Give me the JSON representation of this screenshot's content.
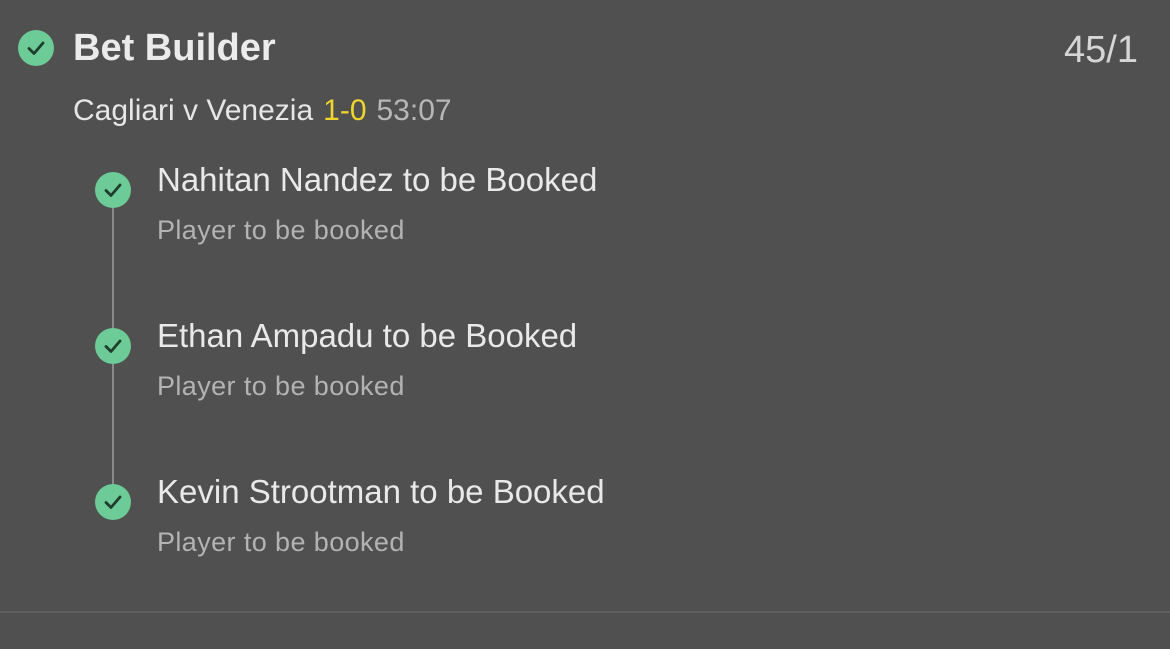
{
  "bet": {
    "title": "Bet Builder",
    "odds": "45/1",
    "status_icon": "check-circle-icon"
  },
  "match": {
    "name": "Cagliari v Venezia",
    "score": "1-0",
    "clock": "53:07"
  },
  "legs": [
    {
      "title": "Nahitan Nandez to be Booked",
      "market": "Player to be booked",
      "status_icon": "check-circle-icon"
    },
    {
      "title": "Ethan Ampadu to be Booked",
      "market": "Player to be booked",
      "status_icon": "check-circle-icon"
    },
    {
      "title": "Kevin Strootman to be Booked",
      "market": "Player to be booked",
      "status_icon": "check-circle-icon"
    }
  ],
  "colors": {
    "background": "#505050",
    "check_green": "#6ccb96",
    "score_yellow": "#f0d52d"
  }
}
